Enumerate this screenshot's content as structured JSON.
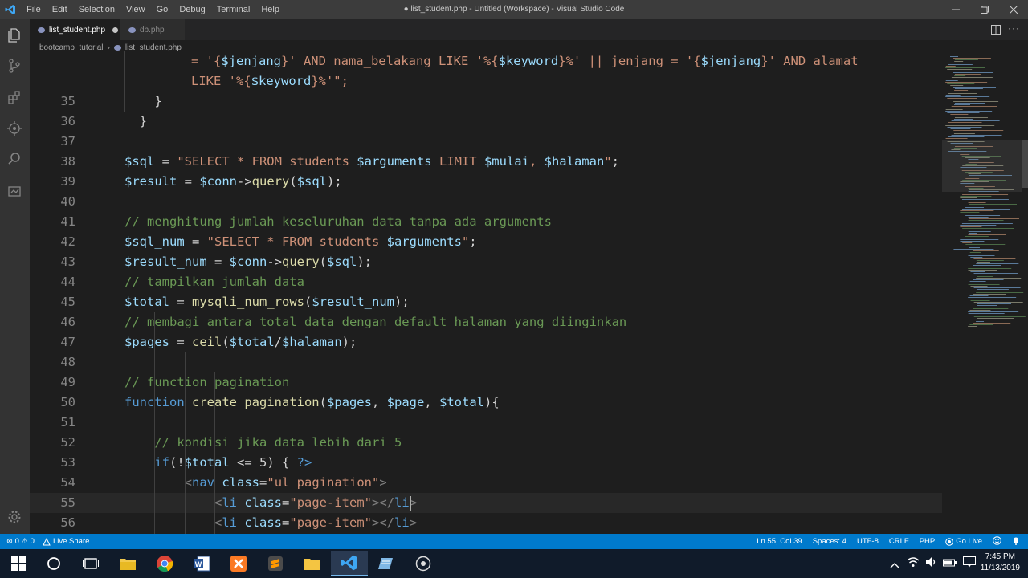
{
  "window": {
    "title": "● list_student.php - Untitled (Workspace) - Visual Studio Code",
    "menu": [
      "File",
      "Edit",
      "Selection",
      "View",
      "Go",
      "Debug",
      "Terminal",
      "Help"
    ]
  },
  "tabs": [
    {
      "label": "list_student.php",
      "active": true,
      "modified": true
    },
    {
      "label": "db.php",
      "active": false,
      "modified": false
    }
  ],
  "breadcrumb": {
    "folder": "bootcamp_tutorial",
    "sep": "›",
    "file": "list_student.php"
  },
  "editor": {
    "wrap_lines": [
      [
        [
          "= '{",
          "s"
        ],
        [
          "$jenjang",
          "v"
        ],
        [
          "}' AND nama_belakang LIKE '%{",
          "s"
        ],
        [
          "$keyword",
          "v"
        ],
        [
          "}%' || jenjang = '{",
          "s"
        ],
        [
          "$jenjang",
          "v"
        ],
        [
          "}' AND alamat",
          "s"
        ]
      ],
      [
        [
          "LIKE '%{",
          "s"
        ],
        [
          "$keyword",
          "v"
        ],
        [
          "}%'\";",
          "s"
        ]
      ]
    ],
    "lines": [
      {
        "n": "35",
        "indent": "    ",
        "tokens": [
          [
            "}",
            "p"
          ]
        ]
      },
      {
        "n": "36",
        "indent": "  ",
        "tokens": [
          [
            "}",
            "p"
          ]
        ]
      },
      {
        "n": "37",
        "indent": "",
        "tokens": []
      },
      {
        "n": "38",
        "indent": "",
        "tokens": [
          [
            "$sql",
            "v"
          ],
          [
            " = ",
            "p"
          ],
          [
            "\"SELECT * FROM students ",
            "s"
          ],
          [
            "$arguments",
            "v"
          ],
          [
            " LIMIT ",
            "s"
          ],
          [
            "$mulai",
            "v"
          ],
          [
            ", ",
            "s"
          ],
          [
            "$halaman",
            "v"
          ],
          [
            "\"",
            "s"
          ],
          [
            ";",
            "p"
          ]
        ]
      },
      {
        "n": "39",
        "indent": "",
        "tokens": [
          [
            "$result",
            "v"
          ],
          [
            " = ",
            "p"
          ],
          [
            "$conn",
            "v"
          ],
          [
            "->",
            "p"
          ],
          [
            "query",
            "f"
          ],
          [
            "(",
            "p"
          ],
          [
            "$sql",
            "v"
          ],
          [
            ");",
            "p"
          ]
        ]
      },
      {
        "n": "40",
        "indent": "",
        "tokens": []
      },
      {
        "n": "41",
        "indent": "",
        "tokens": [
          [
            "// menghitung jumlah keseluruhan data tanpa ada arguments",
            "c"
          ]
        ]
      },
      {
        "n": "42",
        "indent": "",
        "tokens": [
          [
            "$sql_num",
            "v"
          ],
          [
            " = ",
            "p"
          ],
          [
            "\"SELECT * FROM students ",
            "s"
          ],
          [
            "$arguments",
            "v"
          ],
          [
            "\"",
            "s"
          ],
          [
            ";",
            "p"
          ]
        ]
      },
      {
        "n": "43",
        "indent": "",
        "tokens": [
          [
            "$result_num",
            "v"
          ],
          [
            " = ",
            "p"
          ],
          [
            "$conn",
            "v"
          ],
          [
            "->",
            "p"
          ],
          [
            "query",
            "f"
          ],
          [
            "(",
            "p"
          ],
          [
            "$sql",
            "v"
          ],
          [
            ");",
            "p"
          ]
        ]
      },
      {
        "n": "44",
        "indent": "",
        "tokens": [
          [
            "// tampilkan jumlah data",
            "c"
          ]
        ]
      },
      {
        "n": "45",
        "indent": "",
        "tokens": [
          [
            "$total",
            "v"
          ],
          [
            " = ",
            "p"
          ],
          [
            "mysqli_num_rows",
            "f"
          ],
          [
            "(",
            "p"
          ],
          [
            "$result_num",
            "v"
          ],
          [
            ");",
            "p"
          ]
        ]
      },
      {
        "n": "46",
        "indent": "",
        "tokens": [
          [
            "// membagi antara total data dengan default halaman yang diinginkan",
            "c"
          ]
        ]
      },
      {
        "n": "47",
        "indent": "",
        "tokens": [
          [
            "$pages",
            "v"
          ],
          [
            " = ",
            "p"
          ],
          [
            "ceil",
            "f"
          ],
          [
            "(",
            "p"
          ],
          [
            "$total",
            "v"
          ],
          [
            "/",
            "p"
          ],
          [
            "$halaman",
            "v"
          ],
          [
            ");",
            "p"
          ]
        ]
      },
      {
        "n": "48",
        "indent": "",
        "tokens": []
      },
      {
        "n": "49",
        "indent": "",
        "tokens": [
          [
            "// function pagination",
            "c"
          ]
        ]
      },
      {
        "n": "50",
        "indent": "",
        "tokens": [
          [
            "function",
            "k"
          ],
          [
            " ",
            "p"
          ],
          [
            "create_pagination",
            "f"
          ],
          [
            "(",
            "p"
          ],
          [
            "$pages",
            "v"
          ],
          [
            ", ",
            "p"
          ],
          [
            "$page",
            "v"
          ],
          [
            ", ",
            "p"
          ],
          [
            "$total",
            "v"
          ],
          [
            "){",
            "p"
          ]
        ]
      },
      {
        "n": "51",
        "indent": "",
        "tokens": []
      },
      {
        "n": "52",
        "indent": "    ",
        "tokens": [
          [
            "// kondisi jika data lebih dari 5",
            "c"
          ]
        ]
      },
      {
        "n": "53",
        "indent": "    ",
        "tokens": [
          [
            "if",
            "k"
          ],
          [
            "(!",
            "p"
          ],
          [
            "$total",
            "v"
          ],
          [
            " <= 5) { ",
            "p"
          ],
          [
            "?>",
            "k"
          ]
        ]
      },
      {
        "n": "54",
        "indent": "        ",
        "tokens": [
          [
            "<",
            "t"
          ],
          [
            "nav",
            "k"
          ],
          [
            " ",
            "p"
          ],
          [
            "class",
            "a"
          ],
          [
            "=",
            "p"
          ],
          [
            "\"ul pagination\"",
            "s"
          ],
          [
            ">",
            "t"
          ]
        ]
      },
      {
        "n": "55",
        "indent": "            ",
        "tokens": [
          [
            "<",
            "t"
          ],
          [
            "li",
            "k"
          ],
          [
            " ",
            "p"
          ],
          [
            "class",
            "a"
          ],
          [
            "=",
            "p"
          ],
          [
            "\"page-item\"",
            "s"
          ],
          [
            "><",
            "t"
          ],
          [
            "/",
            "t"
          ],
          [
            "li",
            "k"
          ],
          [
            ">",
            "t"
          ]
        ],
        "current": true
      },
      {
        "n": "56",
        "indent": "            ",
        "tokens": [
          [
            "<",
            "t"
          ],
          [
            "li",
            "k"
          ],
          [
            " ",
            "p"
          ],
          [
            "class",
            "a"
          ],
          [
            "=",
            "p"
          ],
          [
            "\"page-item\"",
            "s"
          ],
          [
            "></",
            "t"
          ],
          [
            "li",
            "k"
          ],
          [
            ">",
            "t"
          ]
        ]
      }
    ]
  },
  "status": {
    "problems": "⊗ 0 ⚠ 0",
    "live_share": "Live Share",
    "position": "Ln 55, Col 39",
    "spaces": "Spaces: 4",
    "encoding": "UTF-8",
    "eol": "CRLF",
    "language": "PHP",
    "go_live": "Go Live"
  },
  "taskbar": {
    "time": "7:45 PM",
    "date": "11/13/2019"
  }
}
